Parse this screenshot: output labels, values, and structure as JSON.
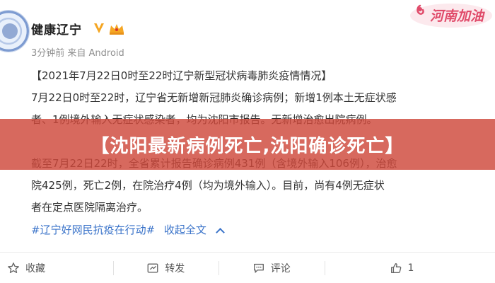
{
  "post": {
    "author": "健康辽宁",
    "meta": "3分钟前 来自 Android",
    "lines": [
      "【2021年7月22日0时至22时辽宁新型冠状病毒肺炎疫情情况】",
      "7月22日0时至22时，辽宁省无新增新冠肺炎确诊病例；新增1例本土无症状感",
      "者、1例境外输入无症状感染者，均为沈阳市报告。无新增治愈出院病例。",
      "",
      "截至7月22日22时，全省累计报告确诊病例431例（含境外输入106例），治愈",
      "院425例，死亡2例，在院治疗4例（均为境外输入）。目前，尚有4例无症状",
      "者在定点医院隔离治疗。"
    ],
    "hashtag": "#辽宁好网民抗疫在行动#",
    "collapse_label": "收起全文"
  },
  "actions": {
    "favorite": "收藏",
    "repost": "转发",
    "comment": "评论",
    "like": "1"
  },
  "watermark": {
    "text": "河南加油"
  },
  "banner": {
    "headline": "【沈阳最新病例死亡,沈阳确诊死亡】"
  },
  "colors": {
    "link": "#3a73c9",
    "banner": "#ce483a",
    "verify": "#f5a623"
  }
}
